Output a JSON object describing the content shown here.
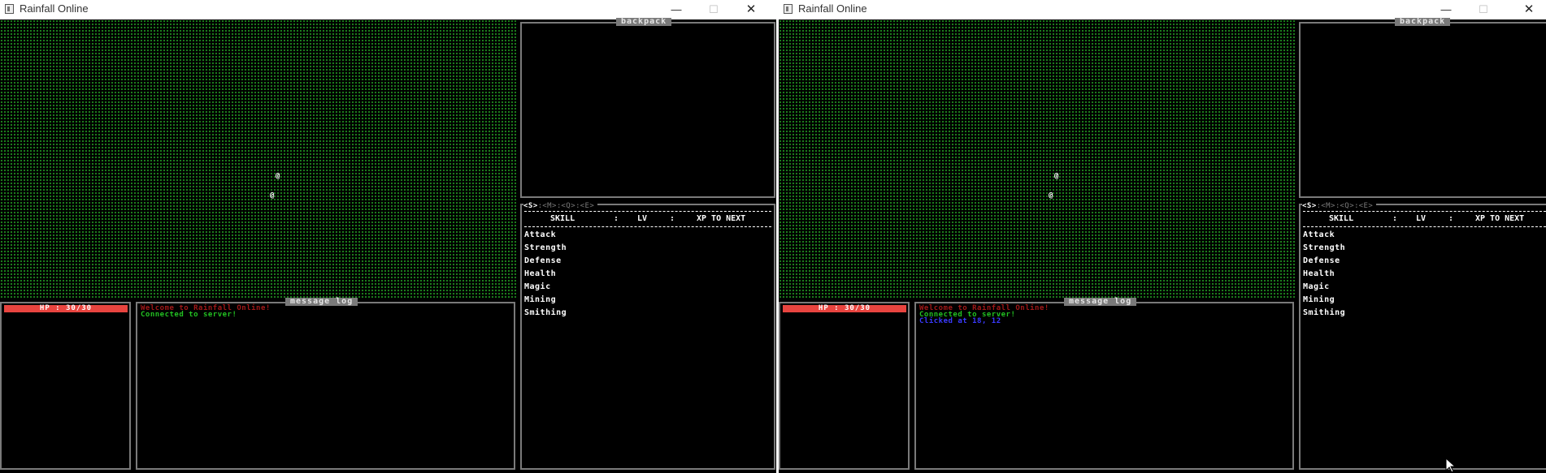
{
  "colors": {
    "map_dot": "#1f8a1f",
    "panel_border": "#7a7a7a",
    "hp_bar": "#e8443f",
    "log_welcome": "#a01818",
    "log_connected": "#22c122",
    "log_click": "#3a3aff"
  },
  "windows": [
    {
      "title": "Rainfall Online",
      "backpack_title": "backpack",
      "tabs": [
        "<S>",
        "<M>",
        "<Q>",
        "<E>"
      ],
      "active_tab": "<S>",
      "skills_header": {
        "skill": "SKILL",
        "lv": "LV",
        "xp": "XP TO NEXT",
        "divider": ":"
      },
      "skills": [
        "Attack",
        "Strength",
        "Defense",
        "Health",
        "Magic",
        "Mining",
        "Smithing"
      ],
      "hp_label": "HP : 30/30",
      "hp_fraction": 1.0,
      "log_title": "message log",
      "log_lines": [
        {
          "text": "Welcome to Rainfall Online!",
          "color": "#a01818"
        },
        {
          "text": "Connected to server!",
          "color": "#22c122"
        }
      ],
      "players": [
        "@",
        "@"
      ]
    },
    {
      "title": "Rainfall Online",
      "backpack_title": "backpack",
      "tabs": [
        "<S>",
        "<M>",
        "<Q>",
        "<E>"
      ],
      "active_tab": "<S>",
      "skills_header": {
        "skill": "SKILL",
        "lv": "LV",
        "xp": "XP TO NEXT",
        "divider": ":"
      },
      "skills": [
        "Attack",
        "Strength",
        "Defense",
        "Health",
        "Magic",
        "Mining",
        "Smithing"
      ],
      "hp_label": "HP : 30/30",
      "hp_fraction": 1.0,
      "log_title": "message log",
      "log_lines": [
        {
          "text": "Welcome to Rainfall Online!",
          "color": "#a01818"
        },
        {
          "text": "Connected to server!",
          "color": "#22c122"
        },
        {
          "text": "Clicked at 18, 12",
          "color": "#3a3aff"
        }
      ],
      "players": [
        "@",
        "@"
      ]
    }
  ],
  "window_controls": {
    "minimize": "—",
    "maximize": "☐",
    "close": "✕"
  },
  "cursor_icon": "mouse-pointer-icon"
}
